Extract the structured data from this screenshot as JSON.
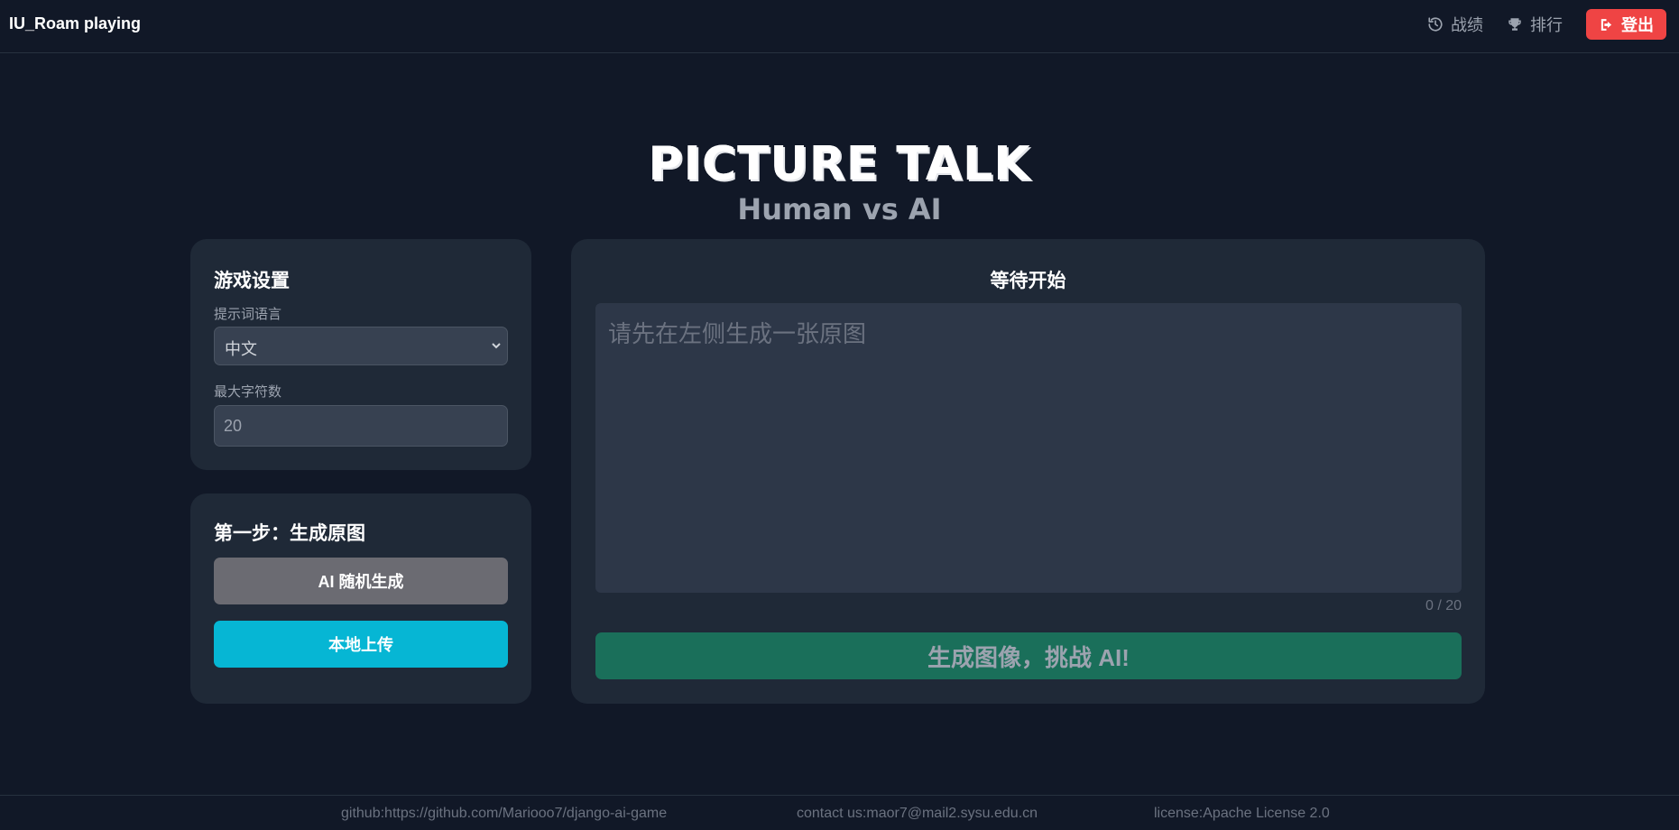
{
  "navbar": {
    "brand": "IU_Roam playing",
    "links": [
      {
        "label": "战绩",
        "icon": "history-icon"
      },
      {
        "label": "排行",
        "icon": "trophy-icon"
      }
    ],
    "logout_label": "登出",
    "logout_color": "#ef4444"
  },
  "hero": {
    "title": "PICTURE TALK",
    "subtitle": "Human vs AI"
  },
  "settings": {
    "title": "游戏设置",
    "language_label": "提示词语言",
    "language_value": "中文",
    "max_chars_label": "最大字符数",
    "max_chars_value": "20"
  },
  "step1": {
    "title": "第一步：生成原图",
    "ai_button": "AI 随机生成",
    "upload_button": "本地上传",
    "upload_color": "#06b6d4"
  },
  "main": {
    "status_title": "等待开始",
    "prompt_placeholder": "请先在左侧生成一张原图",
    "char_count": "0 / 20",
    "generate_button": "生成图像，挑战 AI!",
    "generate_color": "#1a6f5a"
  },
  "footer": {
    "github": "github:https://github.com/Mariooo7/django-ai-game",
    "contact": "contact us:maor7@mail2.sysu.edu.cn",
    "license": "license:Apache License 2.0"
  }
}
